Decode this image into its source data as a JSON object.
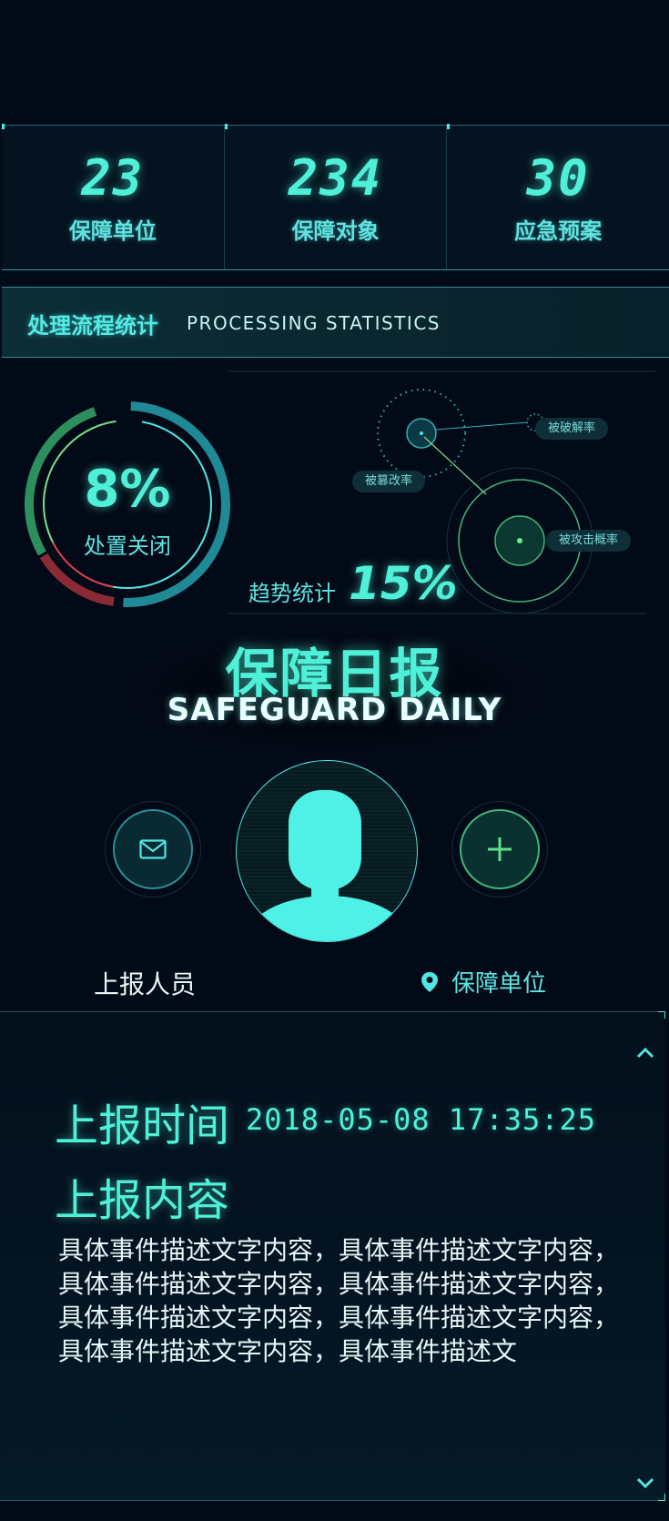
{
  "stats": [
    {
      "value": "23",
      "label": "保障单位"
    },
    {
      "value": "234",
      "label": "保障对象"
    },
    {
      "value": "30",
      "label": "应急预案"
    }
  ],
  "section": {
    "title_cn": "处理流程统计",
    "title_en": "PROCESSING STATISTICS"
  },
  "donut": {
    "percent_text": "8%",
    "label": "处置关闭"
  },
  "radar": {
    "labels": [
      "被破解率",
      "被篡改率",
      "被攻击概率"
    ]
  },
  "trend": {
    "label": "趋势统计",
    "value": "15%"
  },
  "title": {
    "cn": "保障日报",
    "en": "SAFEGUARD DAILY"
  },
  "profile": {
    "reporter_label": "上报人员",
    "unit_label": "保障单位"
  },
  "report": {
    "time_label": "上报时间",
    "time_value": "2018-05-08 17:35:25",
    "content_label": "上报内容",
    "content_text": "具体事件描述文字内容，具体事件描述文字内容，具体事件描述文字内容，具体事件描述文字内容，具体事件描述文字内容，具体事件描述文字内容，具体事件描述文字内容，具体事件描述文"
  },
  "colors": {
    "background": "#030a17",
    "accent": "#4ff0d8",
    "ring_green": "#3fb87a",
    "ring_red": "#c0303a"
  },
  "icons": [
    "mail-icon",
    "plus-icon",
    "location-pin-icon",
    "chevron-up-icon",
    "chevron-down-icon"
  ]
}
